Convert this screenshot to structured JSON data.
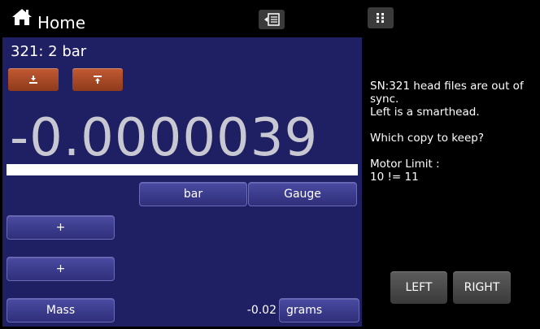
{
  "header": {
    "title": "Home"
  },
  "channel": {
    "label": "321:  2 bar"
  },
  "reading": {
    "value": "-0.0000039",
    "bar_fill_fraction": 1.0
  },
  "buttons": {
    "unit": "bar",
    "mode": "Gauge",
    "plus_1": "+",
    "plus_2": "+",
    "mass": "Mass",
    "mass_unit": "grams",
    "left": "LEFT",
    "right": "RIGHT"
  },
  "mass_value": "-0.02",
  "message": {
    "line1": "SN:321 head files are out of sync.",
    "line2": "Left is a smarthead.",
    "line3": "Which copy to keep?",
    "line4": "Motor Limit :",
    "line5": "10 != 11"
  },
  "icons": {
    "home": "home-icon",
    "menu": "menu-list-icon",
    "apps": "grid-icon",
    "zero": "zero-download-icon",
    "tare": "tare-upload-icon"
  }
}
